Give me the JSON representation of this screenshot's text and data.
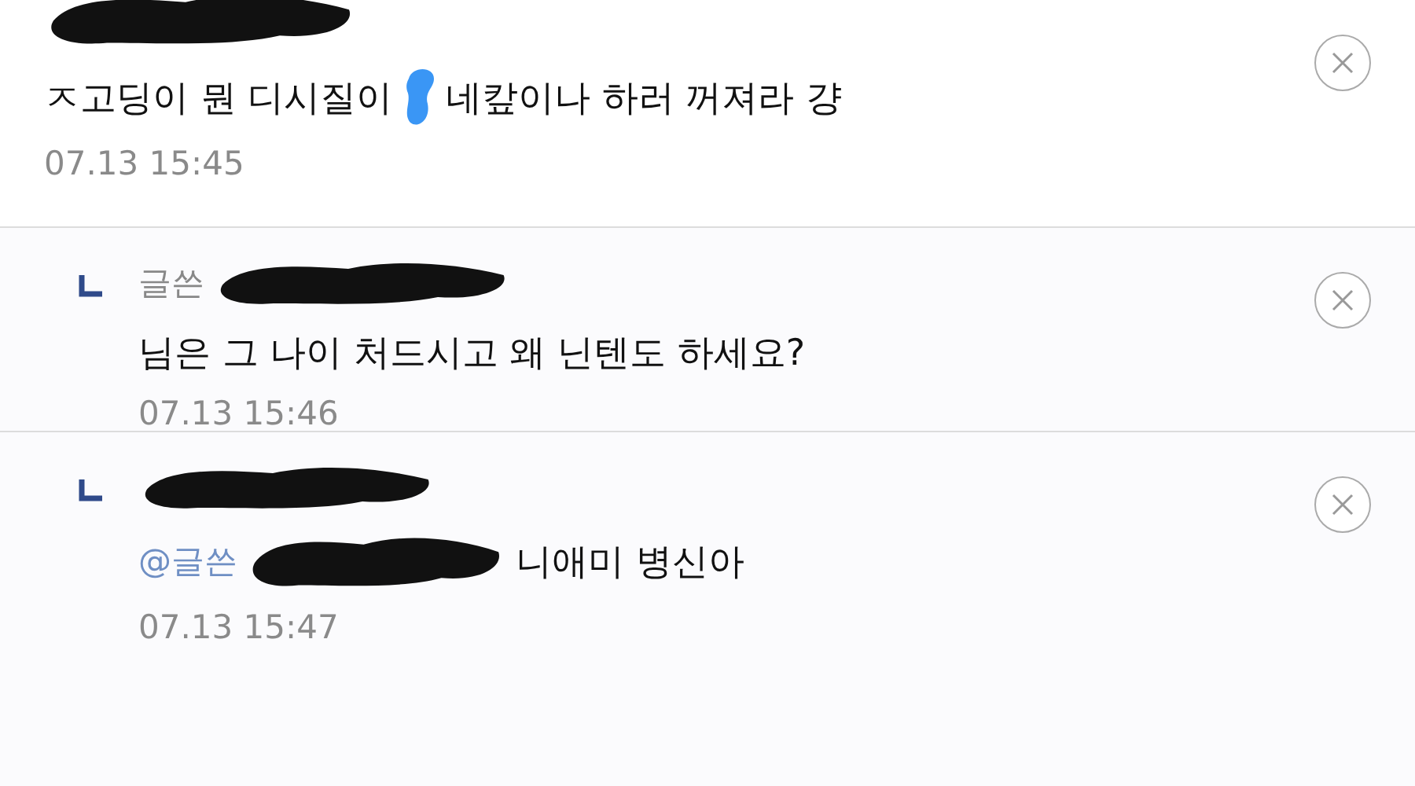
{
  "comments": [
    {
      "kind": "comment",
      "body": [
        {
          "kind": "text",
          "text": "ㅈ고딩이 뭔 디시질이"
        },
        {
          "kind": "scribble",
          "color": "#3a96f5"
        },
        {
          "kind": "text",
          "text": "네캎이나 하러 꺼져라 걍"
        }
      ],
      "time": "07.13 15:45"
    },
    {
      "kind": "reply",
      "author_label": "글쓴",
      "body": [
        {
          "kind": "text",
          "text": "님은 그 나이 처드시고 왜 닌텐도 하세요?"
        }
      ],
      "time": "07.13 15:46"
    },
    {
      "kind": "reply",
      "body": [
        {
          "kind": "mention",
          "text": "@글쓴"
        },
        {
          "kind": "scribble",
          "color": "#111111"
        },
        {
          "kind": "text",
          "text": "니애미 병신아"
        }
      ],
      "time": "07.13 15:47"
    }
  ]
}
